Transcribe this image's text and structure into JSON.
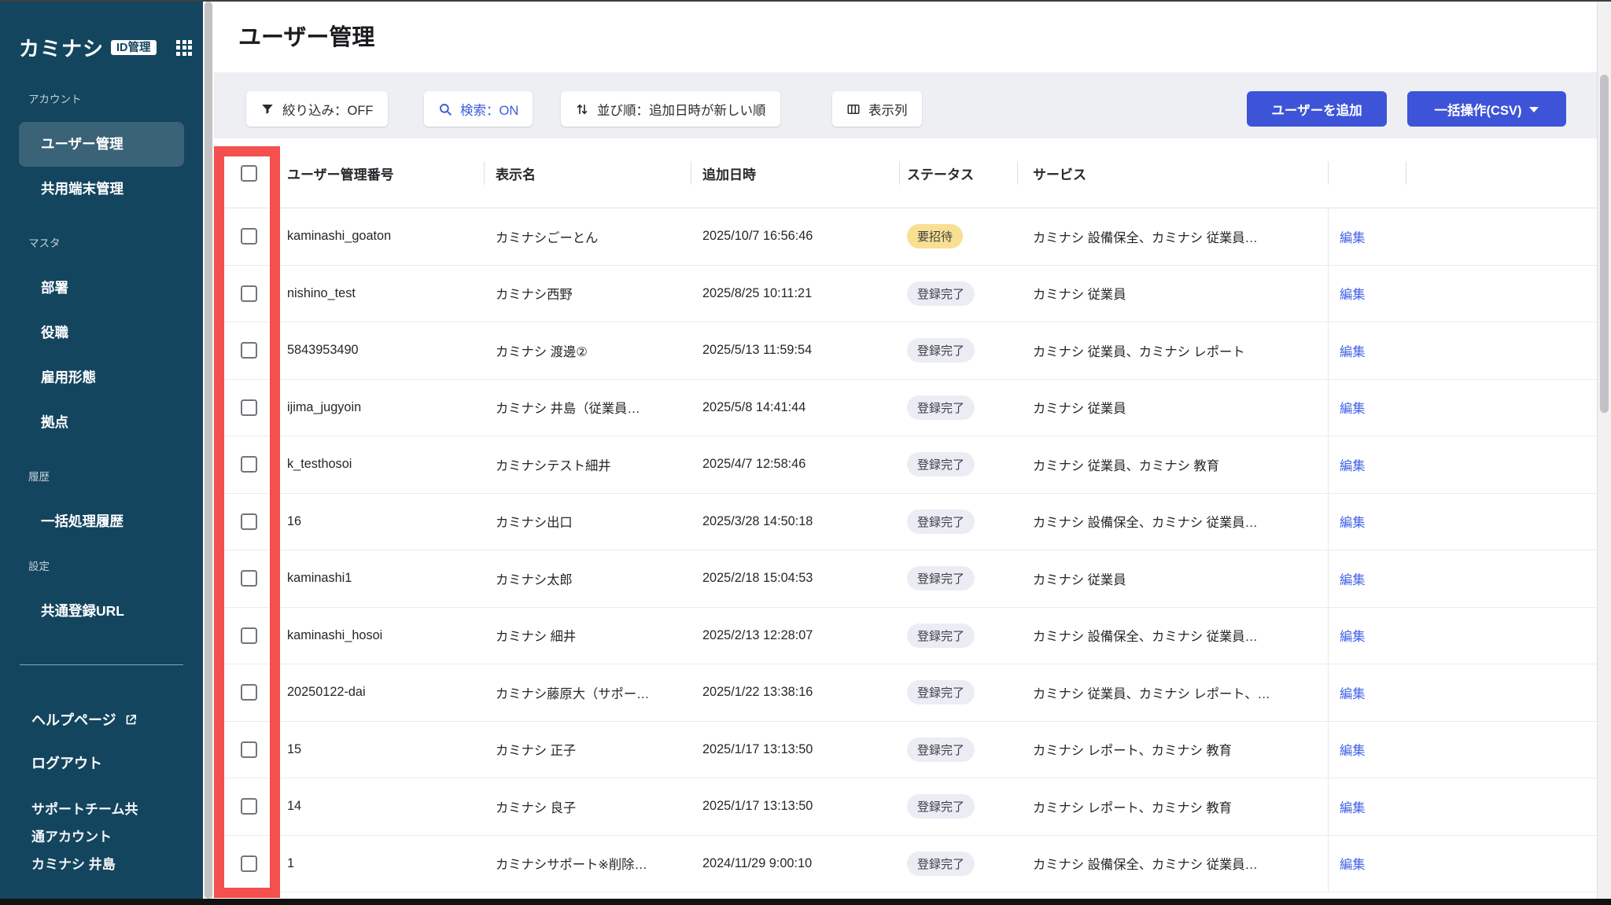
{
  "colors": {
    "sidebar_bg": "#14455F",
    "sidebar_active_bg": "#3B6377",
    "accent_blue": "#3D54D8",
    "link_blue": "#4262E8",
    "search_on_blue": "#3B5CDB",
    "annotation_red": "#F4504D",
    "status": {
      "要招待": "#F8DF92",
      "登録完了": "#ECEDF4"
    }
  },
  "app": {
    "brand": "カミナシ",
    "brand_badge": "ID管理"
  },
  "sidebar": {
    "sections": [
      {
        "label": "アカウント",
        "items": [
          {
            "label": "ユーザー管理",
            "active": true
          },
          {
            "label": "共用端末管理",
            "active": false
          }
        ]
      },
      {
        "label": "マスタ",
        "items": [
          {
            "label": "部署"
          },
          {
            "label": "役職"
          },
          {
            "label": "雇用形態"
          },
          {
            "label": "拠点"
          }
        ]
      },
      {
        "label": "履歴",
        "items": [
          {
            "label": "一括処理履歴"
          }
        ]
      },
      {
        "label": "設定",
        "items": [
          {
            "label": "共通登録URL"
          }
        ]
      }
    ],
    "help_label": "ヘルプページ",
    "logout_label": "ログアウト",
    "account_lines": [
      "サポートチーム共",
      "通アカウント",
      "カミナシ 井島"
    ]
  },
  "header": {
    "title": "ユーザー管理"
  },
  "toolbar": {
    "filter_label": "絞り込み：OFF",
    "search_label": "検索：ON",
    "sort_label": "並び順：追加日時が新しい順",
    "columns_label": "表示列",
    "add_user_label": "ユーザーを追加",
    "bulk_label": "一括操作(CSV)"
  },
  "icons": {
    "app-launcher-icon": "3x3-dot-grid",
    "external-link-icon": "box-with-arrow",
    "filter-icon": "funnel",
    "search-icon": "magnifier",
    "sort-icon": "up-down-arrows",
    "columns-icon": "table-columns",
    "caret-down-icon": "▾"
  },
  "table": {
    "headers": [
      "ユーザー管理番号",
      "表示名",
      "追加日時",
      "ステータス",
      "サービス"
    ],
    "edit_label": "編集",
    "rows": [
      {
        "id": "kaminashi_goaton",
        "name": "カミナシごーとん",
        "added": "2025/10/7 16:56:46",
        "status": "要招待",
        "services": "カミナシ 設備保全、カミナシ 従業員…"
      },
      {
        "id": "nishino_test",
        "name": "カミナシ西野",
        "added": "2025/8/25 10:11:21",
        "status": "登録完了",
        "services": "カミナシ 従業員"
      },
      {
        "id": "5843953490",
        "name": "カミナシ 渡邊②",
        "added": "2025/5/13 11:59:54",
        "status": "登録完了",
        "services": "カミナシ 従業員、カミナシ レポート"
      },
      {
        "id": "ijima_jugyoin",
        "name": "カミナシ 井島（従業員…",
        "added": "2025/5/8 14:41:44",
        "status": "登録完了",
        "services": "カミナシ 従業員"
      },
      {
        "id": "k_testhosoi",
        "name": "カミナシテスト細井",
        "added": "2025/4/7 12:58:46",
        "status": "登録完了",
        "services": "カミナシ 従業員、カミナシ 教育"
      },
      {
        "id": "16",
        "name": "カミナシ出口",
        "added": "2025/3/28 14:50:18",
        "status": "登録完了",
        "services": "カミナシ 設備保全、カミナシ 従業員…"
      },
      {
        "id": "kaminashi1",
        "name": "カミナシ太郎",
        "added": "2025/2/18 15:04:53",
        "status": "登録完了",
        "services": "カミナシ 従業員"
      },
      {
        "id": "kaminashi_hosoi",
        "name": "カミナシ 細井",
        "added": "2025/2/13 12:28:07",
        "status": "登録完了",
        "services": "カミナシ 設備保全、カミナシ 従業員…"
      },
      {
        "id": "20250122-dai",
        "name": "カミナシ藤原大（サポー…",
        "added": "2025/1/22 13:38:16",
        "status": "登録完了",
        "services": "カミナシ 従業員、カミナシ レポート、…"
      },
      {
        "id": "15",
        "name": "カミナシ 正子",
        "added": "2025/1/17 13:13:50",
        "status": "登録完了",
        "services": "カミナシ レポート、カミナシ 教育"
      },
      {
        "id": "14",
        "name": "カミナシ 良子",
        "added": "2025/1/17 13:13:50",
        "status": "登録完了",
        "services": "カミナシ レポート、カミナシ 教育"
      },
      {
        "id": "1",
        "name": "カミナシサポート※削除…",
        "added": "2024/11/29 9:00:10",
        "status": "登録完了",
        "services": "カミナシ 設備保全、カミナシ 従業員…"
      }
    ]
  }
}
